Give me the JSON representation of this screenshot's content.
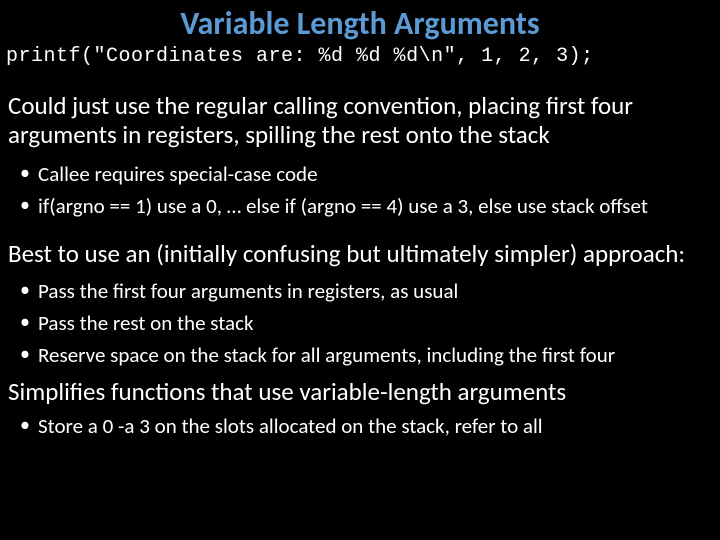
{
  "title": "Variable Length Arguments",
  "code": "printf(\"Coordinates are: %d %d %d\\n\", 1, 2, 3);",
  "para1": "Could just use the regular calling convention, placing first four arguments in registers, spilling the rest onto the stack",
  "bullets1": [
    "Callee requires special-case code",
    "if(argno == 1) use a 0, … else if (argno == 4) use a 3, else use stack offset"
  ],
  "para2": "Best to use an (initially confusing but ultimately simpler) approach:",
  "bullets2": [
    "Pass the first four arguments in registers, as usual",
    "Pass the rest on the stack",
    "Reserve space on the stack for all arguments, including the first four"
  ],
  "para3": "Simplifies functions that use variable-length arguments",
  "bullets3": [
    "Store a 0 -a 3 on the slots allocated on the stack, refer to all"
  ]
}
